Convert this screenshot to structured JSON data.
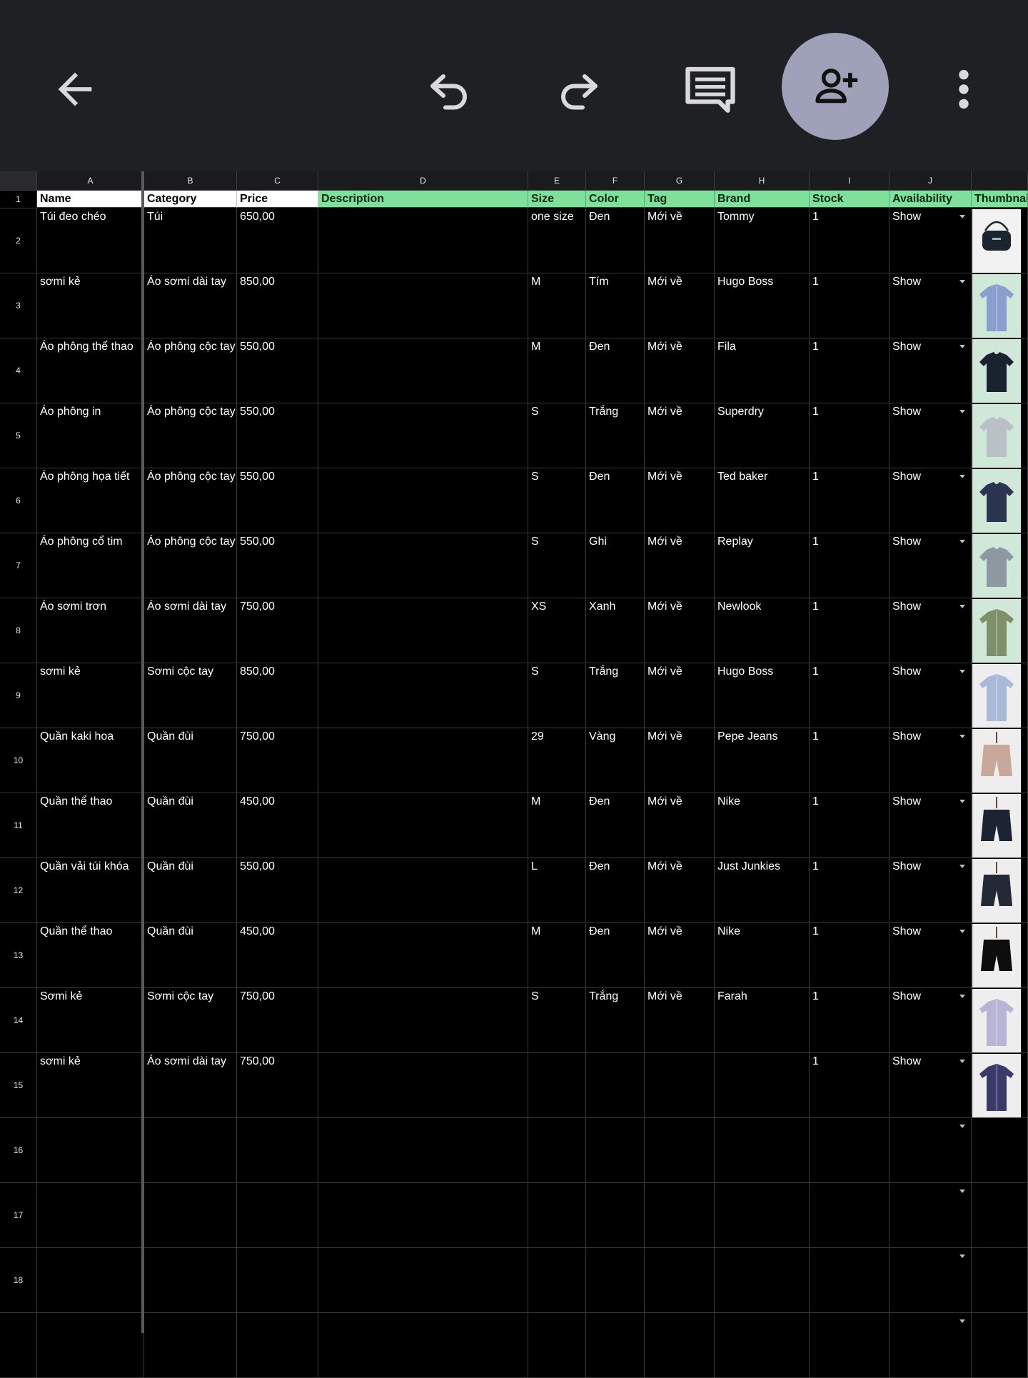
{
  "toolbar": {
    "back_icon": "arrow-left-icon",
    "undo_icon": "undo-icon",
    "redo_icon": "redo-icon",
    "comment_icon": "comment-icon",
    "share_icon": "person-add-icon",
    "more_icon": "more-vert-icon"
  },
  "colors": {
    "app_bar": "#1f2024",
    "share_button": "#9ea1b8",
    "header_green": "#7ee09b",
    "grid_line": "#3a3a3c"
  },
  "columns": [
    "A",
    "B",
    "C",
    "D",
    "E",
    "F",
    "G",
    "H",
    "I",
    "J"
  ],
  "row_numbers": [
    "1",
    "2",
    "3",
    "4",
    "5",
    "6",
    "7",
    "8",
    "9",
    "10",
    "11",
    "12",
    "13",
    "14",
    "15",
    "16",
    "17",
    "18"
  ],
  "headers": [
    "Name",
    "Category",
    "Price",
    "Description",
    "Size",
    "Color",
    "Tag",
    "Brand",
    "Stock",
    "Availability",
    "Thumbnail"
  ],
  "rows": [
    [
      "Túi đeo chéo",
      "Túi",
      "650,00",
      "",
      "one size",
      "Đen",
      "Mới về",
      "Tommy",
      "1",
      "Show"
    ],
    [
      "sơmi kẻ",
      "Áo sơmi dài tay",
      "850,00",
      "",
      "M",
      "Tím",
      "Mới về",
      "Hugo Boss",
      "1",
      "Show"
    ],
    [
      "Áo phông thể thao",
      "Áo phông cộc tay",
      "550,00",
      "",
      "M",
      "Đen",
      "Mới về",
      "Fila",
      "1",
      "Show"
    ],
    [
      "Áo phông in",
      "Áo phông cộc tay",
      "550,00",
      "",
      "S",
      "Trắng",
      "Mới về",
      "Superdry",
      "1",
      "Show"
    ],
    [
      "Áo phông họa tiết",
      "Áo phông cộc tay",
      "550,00",
      "",
      "S",
      "Đen",
      "Mới về",
      "Ted baker",
      "1",
      "Show"
    ],
    [
      "Áo phông cổ tim",
      "Áo phông cộc tay",
      "550,00",
      "",
      "S",
      "Ghi",
      "Mới về",
      "Replay",
      "1",
      "Show"
    ],
    [
      "Áo sơmi trơn",
      "Áo sơmi dài tay",
      "750,00",
      "",
      "XS",
      "Xanh",
      "Mới về",
      "Newlook",
      "1",
      "Show"
    ],
    [
      "sơmi kẻ",
      "Sơmi cộc tay",
      "850,00",
      "",
      "S",
      "Trắng",
      "Mới về",
      "Hugo Boss",
      "1",
      "Show"
    ],
    [
      "Quần kaki hoa",
      "Quần đùi",
      "750,00",
      "",
      "29",
      "Vàng",
      "Mới về",
      "Pepe Jeans",
      "1",
      "Show"
    ],
    [
      "Quần thể thao",
      "Quần đùi",
      "450,00",
      "",
      "M",
      "Đen",
      "Mới về",
      "Nike",
      "1",
      "Show"
    ],
    [
      "Quần vải túi khóa",
      "Quần đùi",
      "550,00",
      "",
      "L",
      "Đen",
      "Mới về",
      "Just Junkies",
      "1",
      "Show"
    ],
    [
      "Quần thể thao",
      "Quần đùi",
      "450,00",
      "",
      "M",
      "Đen",
      "Mới về",
      "Nike",
      "1",
      "Show"
    ],
    [
      "Sơmi kẻ",
      "Sơmi cộc tay",
      "750,00",
      "",
      "S",
      "Trắng",
      "Mới về",
      "Farah",
      "1",
      "Show"
    ],
    [
      "sơmi kẻ",
      "Áo sơmi dài tay",
      "750,00",
      "",
      "",
      "",
      "",
      "",
      "1",
      "Show"
    ],
    [
      "",
      "",
      "",
      "",
      "",
      "",
      "",
      "",
      "",
      ""
    ],
    [
      "",
      "",
      "",
      "",
      "",
      "",
      "",
      "",
      "",
      ""
    ],
    [
      "",
      "",
      "",
      "",
      "",
      "",
      "",
      "",
      "",
      ""
    ]
  ],
  "thumbnails": [
    {
      "item": "bag",
      "bg": "#f2f2f2",
      "fg": "#1a2530"
    },
    {
      "item": "shirt",
      "bg": "#cfe8d8",
      "fg": "#8a9fd0"
    },
    {
      "item": "tshirt",
      "bg": "#cfe8d8",
      "fg": "#1a2230"
    },
    {
      "item": "tshirt",
      "bg": "#cfe8d8",
      "fg": "#b9c0c6"
    },
    {
      "item": "tshirt",
      "bg": "#cfe8d8",
      "fg": "#2c3550"
    },
    {
      "item": "tshirt",
      "bg": "#cfe8d8",
      "fg": "#8d98a2"
    },
    {
      "item": "shirt",
      "bg": "#cfe8d8",
      "fg": "#7f8f6a"
    },
    {
      "item": "shirt",
      "bg": "#eeeeee",
      "fg": "#a9b9d8"
    },
    {
      "item": "shorts",
      "bg": "#eeeeee",
      "fg": "#c7a89a"
    },
    {
      "item": "shorts",
      "bg": "#eeeeee",
      "fg": "#1c2433"
    },
    {
      "item": "shorts",
      "bg": "#eeeeee",
      "fg": "#232a36"
    },
    {
      "item": "shorts",
      "bg": "#eeeeee",
      "fg": "#0d0d0d"
    },
    {
      "item": "shirt",
      "bg": "#eeeeee",
      "fg": "#b7b4d6"
    },
    {
      "item": "shirt",
      "bg": "#eeeeee",
      "fg": "#3a3a6a"
    }
  ]
}
